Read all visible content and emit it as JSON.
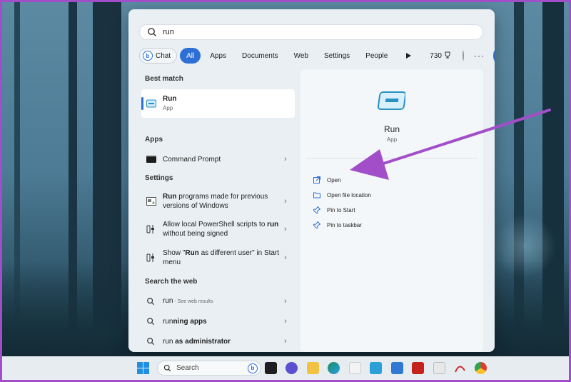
{
  "search": {
    "query": "run"
  },
  "filters": {
    "chat": "Chat",
    "all": "All",
    "apps": "Apps",
    "documents": "Documents",
    "web": "Web",
    "settings": "Settings",
    "people": "People",
    "count": "730"
  },
  "left": {
    "best_match_title": "Best match",
    "best": {
      "name": "Run",
      "type": "App"
    },
    "apps_title": "Apps",
    "apps": [
      {
        "name": "Command Prompt"
      }
    ],
    "settings_title": "Settings",
    "settings": [
      {
        "bold": "Run",
        "rest": " programs made for previous versions of Windows"
      },
      {
        "pre": "Allow local PowerShell scripts to ",
        "bold": "run",
        "post": " without being signed"
      },
      {
        "pre": "Show \"",
        "bold": "Run",
        "post": " as different user\" in Start menu"
      }
    ],
    "web_title": "Search the web",
    "web": [
      {
        "bold": "",
        "pre": "run",
        "hint": " - See web results"
      },
      {
        "pre": "run",
        "bold": "ning apps"
      },
      {
        "pre": "run ",
        "bold": "as administrator"
      }
    ]
  },
  "right": {
    "app_name": "Run",
    "app_type": "App",
    "actions": [
      "Open",
      "Open file location",
      "Pin to Start",
      "Pin to taskbar"
    ]
  },
  "taskbar": {
    "search_label": "Search"
  },
  "colors": {
    "accent": "#2e6fd6",
    "annotation": "#a24ec9"
  }
}
